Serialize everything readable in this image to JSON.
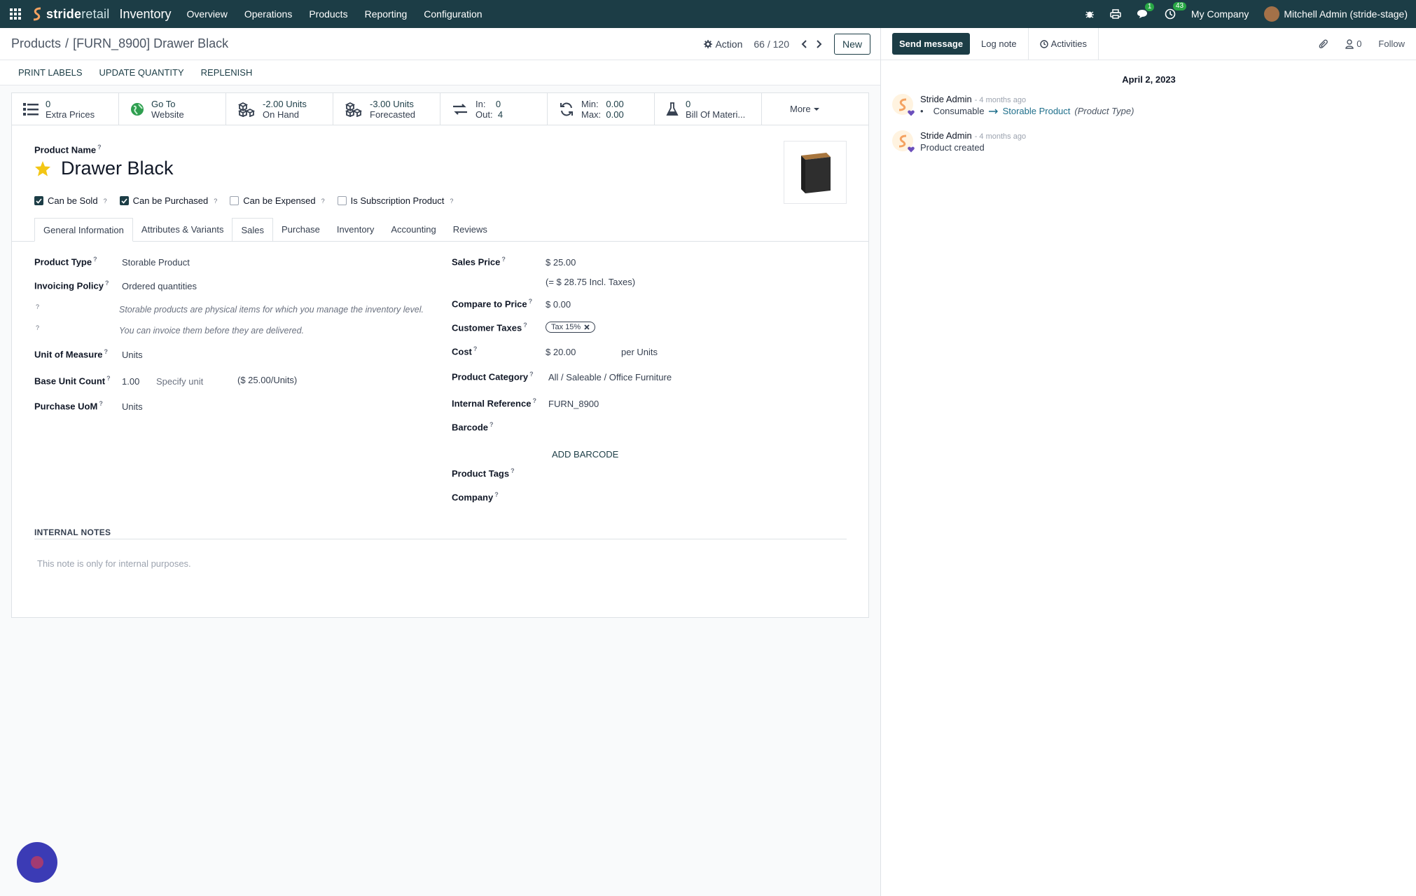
{
  "navbar": {
    "brand_bold": "stride",
    "brand_light": "retail",
    "app_title": "Inventory",
    "menu": [
      "Overview",
      "Operations",
      "Products",
      "Reporting",
      "Configuration"
    ],
    "chat_badge": "1",
    "activity_badge": "43",
    "company": "My Company",
    "user": "Mitchell Admin (stride-stage)"
  },
  "control": {
    "breadcrumb_root": "Products",
    "breadcrumb_sep": "/",
    "breadcrumb_current": "[FURN_8900] Drawer Black",
    "action_label": "Action",
    "pager": "66 / 120",
    "new_label": "New"
  },
  "statusbar": {
    "buttons": [
      "PRINT LABELS",
      "UPDATE QUANTITY",
      "REPLENISH"
    ]
  },
  "smart_buttons": {
    "extra_prices_value": "0",
    "extra_prices_label": "Extra Prices",
    "website_line1": "Go To",
    "website_line2": "Website",
    "onhand_value": "-2.00 Units",
    "onhand_label": "On Hand",
    "forecast_value": "-3.00 Units",
    "forecast_label": "Forecasted",
    "in_label": "In:",
    "in_value": "0",
    "out_label": "Out:",
    "out_value": "4",
    "min_label": "Min:",
    "min_value": "0.00",
    "max_label": "Max:",
    "max_value": "0.00",
    "bom_value": "0",
    "bom_label": "Bill Of Materi...",
    "more_label": "More"
  },
  "product": {
    "name_label": "Product Name",
    "name": "Drawer Black",
    "checkboxes": [
      {
        "label": "Can be Sold",
        "checked": true
      },
      {
        "label": "Can be Purchased",
        "checked": true
      },
      {
        "label": "Can be Expensed",
        "checked": false
      },
      {
        "label": "Is Subscription Product",
        "checked": false
      }
    ]
  },
  "tabs": [
    "General Information",
    "Attributes & Variants",
    "Sales",
    "Purchase",
    "Inventory",
    "Accounting",
    "Reviews"
  ],
  "general": {
    "product_type_label": "Product Type",
    "product_type": "Storable Product",
    "invoicing_policy_label": "Invoicing Policy",
    "invoicing_policy": "Ordered quantities",
    "help_type": "Storable products are physical items for which you manage the inventory level.",
    "help_invoice": "You can invoice them before they are delivered.",
    "uom_label": "Unit of Measure",
    "uom": "Units",
    "base_unit_label": "Base Unit Count",
    "base_unit_count": "1.00",
    "specify_unit": "Specify unit",
    "base_unit_price": "($ 25.00/Units)",
    "purchase_uom_label": "Purchase UoM",
    "purchase_uom": "Units",
    "sales_price_label": "Sales Price",
    "sales_price": "$ 25.00",
    "incl_taxes": "(= $ 28.75 Incl. Taxes)",
    "compare_label": "Compare to Price",
    "compare_price": "$ 0.00",
    "taxes_label": "Customer Taxes",
    "tax_tag": "Tax 15%",
    "cost_label": "Cost",
    "cost": "$ 20.00",
    "cost_per": "per Units",
    "category_label": "Product Category",
    "category": "All / Saleable / Office Furniture",
    "internal_ref_label": "Internal Reference",
    "internal_ref": "FURN_8900",
    "barcode_label": "Barcode",
    "add_barcode": "ADD BARCODE",
    "tags_label": "Product Tags",
    "company_label": "Company"
  },
  "notes": {
    "title": "INTERNAL NOTES",
    "placeholder": "This note is only for internal purposes."
  },
  "chatter": {
    "send_message": "Send message",
    "log_note": "Log note",
    "activities": "Activities",
    "followers_count": "0",
    "follow": "Follow",
    "date": "April 2, 2023",
    "messages": [
      {
        "author": "Stride Admin",
        "time": "- 4 months ago",
        "old_value": "Consumable",
        "new_value": "Storable Product",
        "field": "(Product Type)"
      },
      {
        "author": "Stride Admin",
        "time": "- 4 months ago",
        "body": "Product created"
      }
    ]
  },
  "colors": {
    "navbar": "#1c3d46",
    "accent": "#1c3d46",
    "star": "#f3c614",
    "link": "#1f6f8b"
  }
}
